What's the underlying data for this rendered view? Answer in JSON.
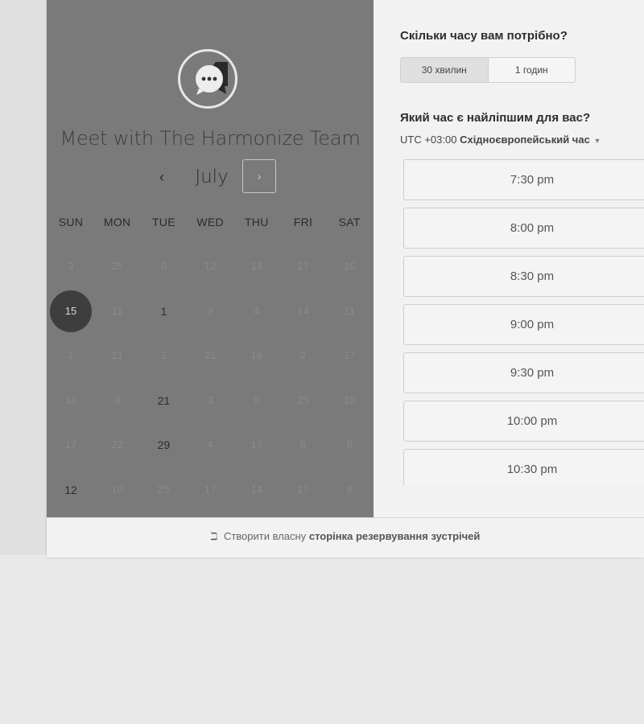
{
  "left_panel": {
    "title": "Meet with The Harmonize Team",
    "avatar_icon": "chat-bubble-icon",
    "month": "July",
    "prev_icon": "‹",
    "next_icon": "›",
    "weekdays": [
      "SUN",
      "MON",
      "TUE",
      "WED",
      "THU",
      "FRI",
      "SAT"
    ],
    "weeks": [
      [
        "3",
        "25",
        "6",
        "12",
        "13",
        "17",
        "16"
      ],
      [
        "15",
        "11",
        "1",
        "3",
        "4",
        "14",
        "11"
      ],
      [
        "1",
        "21",
        "2",
        "21",
        "16",
        "2",
        "17"
      ],
      [
        "16",
        "9",
        "21",
        "3",
        "9",
        "25",
        "10"
      ],
      [
        "17",
        "22",
        "29",
        "4",
        "17",
        "6",
        "8"
      ],
      [
        "12",
        "10",
        "25",
        "17",
        "14",
        "17",
        "8"
      ]
    ],
    "selected_day": "15",
    "active_cells": [
      [
        1,
        0
      ],
      [
        1,
        2
      ],
      [
        3,
        2
      ],
      [
        4,
        2
      ],
      [
        5,
        0
      ]
    ],
    "colors": {
      "panel_bg": "#7a7a7a",
      "selected_bg": "#3e3e3e"
    }
  },
  "right_panel": {
    "duration_question": "Скільки часу вам потрібно?",
    "duration_options": [
      "30 хвилин",
      "1 годин"
    ],
    "selected_duration": "30 хвилин",
    "time_question": "Який час є найліпшим для вас?",
    "timezone_offset": "UTC +03:00",
    "timezone_name": "Східноєвропейський час",
    "timezone_caret": "▾",
    "time_slots": [
      "7:30 pm",
      "8:00 pm",
      "8:30 pm",
      "9:00 pm",
      "9:30 pm",
      "10:00 pm",
      "10:30 pm"
    ]
  },
  "footer": {
    "icon": "hubspot-sprocket-icon",
    "icon_glyph": "ℶ",
    "text": "Створити власну",
    "link": "сторінка резервування зустрічей"
  }
}
